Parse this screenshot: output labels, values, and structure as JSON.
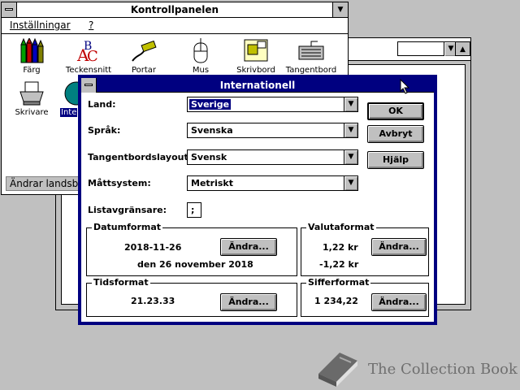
{
  "control_panel": {
    "title": "Kontrollpanelen",
    "menu": [
      {
        "label": "Inställningar",
        "underline": "I"
      },
      {
        "label": "?",
        "underline": "?"
      }
    ],
    "icons": [
      {
        "label": "Färg"
      },
      {
        "label": "Teckensnitt"
      },
      {
        "label": "Portar"
      },
      {
        "label": "Mus"
      },
      {
        "label": "Skrivbord"
      },
      {
        "label": "Tangentbord"
      },
      {
        "label": "Skrivare"
      },
      {
        "label": "Inte"
      }
    ],
    "status": "Ändrar landsb"
  },
  "dialog": {
    "title": "Internationell",
    "fields": {
      "land": {
        "label": "Land:",
        "value": "Sverige"
      },
      "sprak": {
        "label": "Språk:",
        "value": "Svenska"
      },
      "tangentbord": {
        "label": "Tangentbordslayout:",
        "value": "Svensk"
      },
      "matt": {
        "label": "Måttsystem:",
        "value": "Metriskt"
      },
      "lista": {
        "label": "Listavgränsare:",
        "value": ";"
      }
    },
    "buttons": {
      "ok": "OK",
      "avbryt": "Avbryt",
      "hjalp": "Hjälp"
    },
    "groups": {
      "datum": {
        "title": "Datumformat",
        "short": "2018-11-26",
        "long": "den 26 november 2018",
        "change": "Ändra..."
      },
      "valuta": {
        "title": "Valutaformat",
        "positive": "1,22 kr",
        "negative": "-1,22 kr",
        "change": "Ändra..."
      },
      "tid": {
        "title": "Tidsformat",
        "value": "21.23.33",
        "change": "Ändra..."
      },
      "siffer": {
        "title": "Sifferformat",
        "value": "1 234,22",
        "change": "Ändra..."
      }
    }
  },
  "watermark": {
    "text": "The Collection Book"
  },
  "colors": {
    "title_active": "#000080",
    "desktop": "#c0c0c0",
    "selection": "#000080"
  }
}
